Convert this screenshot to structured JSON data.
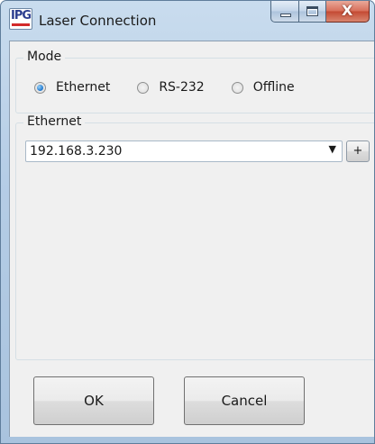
{
  "window": {
    "title": "Laser Connection",
    "logo_text": "IPG",
    "colors": {
      "frame": "#b5cde6",
      "close_button": "#c44a33",
      "accent_radio": "#2b82d6"
    },
    "controls": {
      "minimize_icon": "minimize-icon",
      "maximize_icon": "maximize-icon",
      "close_icon": "close-icon",
      "close_glyph": "X"
    }
  },
  "mode": {
    "legend": "Mode",
    "options": [
      {
        "label": "Ethernet",
        "checked": true
      },
      {
        "label": "RS-232",
        "checked": false
      },
      {
        "label": "Offline",
        "checked": false
      }
    ]
  },
  "ethernet": {
    "legend": "Ethernet",
    "selected_address": "192.168.3.230",
    "dropdown_glyph": "▼",
    "add_label": "+"
  },
  "buttons": {
    "ok_label": "OK",
    "cancel_label": "Cancel"
  }
}
